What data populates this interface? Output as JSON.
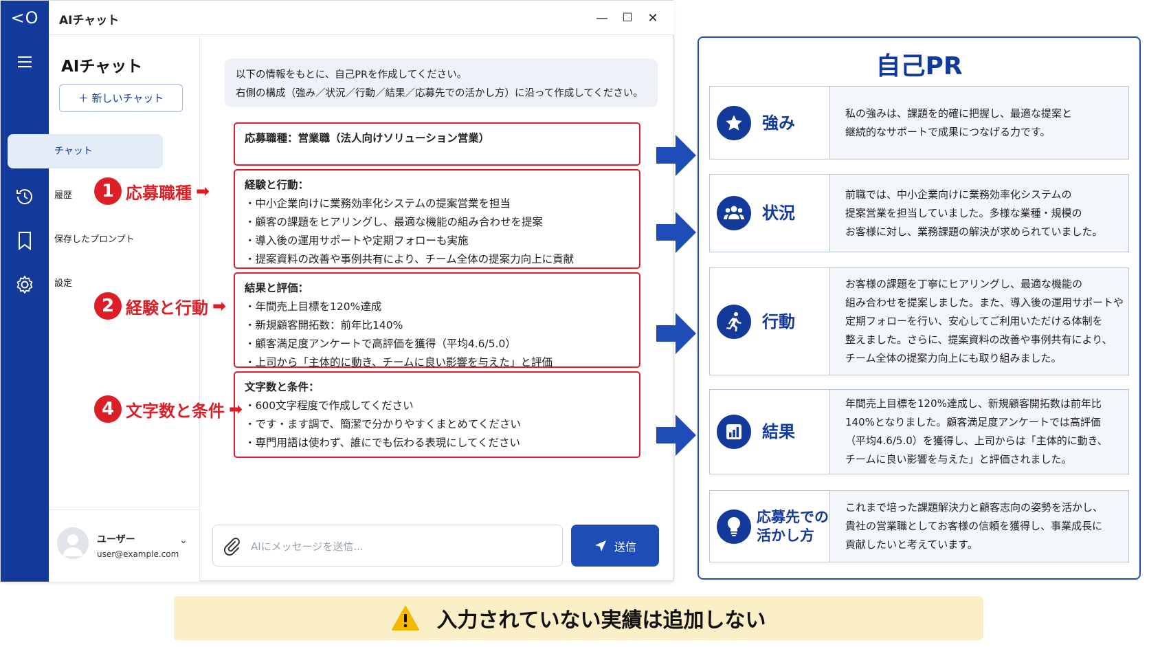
{
  "window": {
    "logo": "<O",
    "title": "AIチャット",
    "minimize": "—",
    "maximize": "☐",
    "close": "✕"
  },
  "sidebar": {
    "title": "AIチャット",
    "new_chat": "＋ 新しいチャット",
    "nav": [
      {
        "label": "チャット",
        "icon": "chat-bubble-icon"
      },
      {
        "label": "履歴",
        "icon": "history-icon"
      },
      {
        "label": "保存したプロンプト",
        "icon": "bookmark-icon"
      },
      {
        "label": "設定",
        "icon": "gear-icon"
      }
    ],
    "user": {
      "name": "ユーザー",
      "email": "user@example.com"
    }
  },
  "chat": {
    "prompt_line1": "以下の情報をもとに、自己PRを作成してください。",
    "prompt_line2": "右側の構成（強み／状況／行動／結果／応募先での活かし方）に沿って作成してください。",
    "box1": {
      "heading": "応募職種：営業職（法人向けソリューション営業）"
    },
    "box2": {
      "heading": "経験と行動：",
      "items": [
        "・中小企業向けに業務効率化システムの提案営業を担当",
        "・顧客の課題をヒアリングし、最適な機能の組み合わせを提案",
        "・導入後の運用サポートや定期フォローも実施",
        "・提案資料の改善や事例共有により、チーム全体の提案力向上に貢献"
      ]
    },
    "box3": {
      "heading": "結果と評価：",
      "items": [
        "・年間売上目標を120%達成",
        "・新規顧客開拓数：前年比140%",
        "・顧客満足度アンケートで高評価を獲得（平均4.6/5.0）",
        "・上司から「主体的に動き、チームに良い影響を与えた」と評価"
      ]
    },
    "box4": {
      "heading": "文字数と条件：",
      "items": [
        "・600文字程度で作成してください",
        "・です・ます調で、簡潔で分かりやすくまとめてください",
        "・専門用語は使わず、誰にでも伝わる表現にしてください"
      ]
    },
    "input_placeholder": "AIにメッセージを送信...",
    "send": "送信"
  },
  "callouts": [
    {
      "num": "1",
      "text": "応募職種",
      "arrow": "➡"
    },
    {
      "num": "2",
      "text": "経験と行動",
      "arrow": "➡"
    },
    {
      "num": "4",
      "text": "文字数と条件",
      "arrow": "➡"
    }
  ],
  "pr_panel": {
    "title": "自己PR",
    "rows": [
      {
        "label": "強み",
        "icon": "star-icon",
        "text": [
          "私の強みは、課題を的確に把握し、最適な提案と",
          "継続的なサポートで成果につなげる力です。"
        ]
      },
      {
        "label": "状況",
        "icon": "people-icon",
        "text": [
          "前職では、中小企業向けに業務効率化システムの",
          "提案営業を担当していました。多様な業種・規模の",
          "お客様に対し、業務課題の解決が求められていました。"
        ]
      },
      {
        "label": "行動",
        "icon": "running-person-icon",
        "text": [
          "お客様の課題を丁寧にヒアリングし、最適な機能の",
          "組み合わせを提案しました。また、導入後の運用サポートや",
          "定期フォローを行い、安心してご利用いただける体制を",
          "整えました。さらに、提案資料の改善や事例共有により、",
          "チーム全体の提案力向上にも取り組みました。"
        ]
      },
      {
        "label": "結果",
        "icon": "bar-chart-icon",
        "text": [
          "年間売上目標を120%達成し、新規顧客開拓数は前年比",
          "140%となりました。顧客満足度アンケートでは高評価",
          "（平均4.6/5.0）を獲得し、上司からは「主体的に動き、",
          "チームに良い影響を与えた」と評価されました。"
        ]
      },
      {
        "label1": "応募先での",
        "label2": "活かし方",
        "icon": "lightbulb-icon",
        "text": [
          "これまで培った課題解決力と顧客志向の姿勢を活かし、",
          "貴社の営業職としてお客様の信頼を獲得し、事業成長に",
          "貢献したいと考えています。"
        ]
      }
    ]
  },
  "warning": {
    "icon": "warning-icon",
    "text": "入力されていない実績は追加しない"
  }
}
